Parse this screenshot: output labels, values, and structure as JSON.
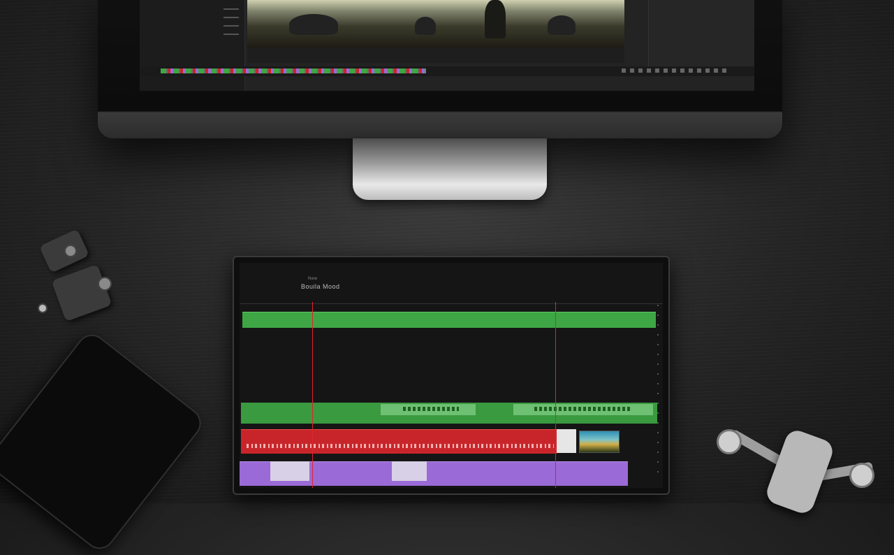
{
  "scene": {
    "description_tags": [
      "monitor-icon",
      "tablet-icon",
      "smartphone-icon",
      "camera-gimbal-icon",
      "drone-icon"
    ],
    "colors": {
      "desk": "#242424",
      "track_green": "#3ea645",
      "track_red": "#c8252a",
      "track_purple": "#9a6ad6",
      "playhead": "#e0242b"
    }
  },
  "tablet": {
    "title_small": "New",
    "title": "Bouila Mood",
    "ruler_labels": [],
    "audio_bar_text": ""
  }
}
